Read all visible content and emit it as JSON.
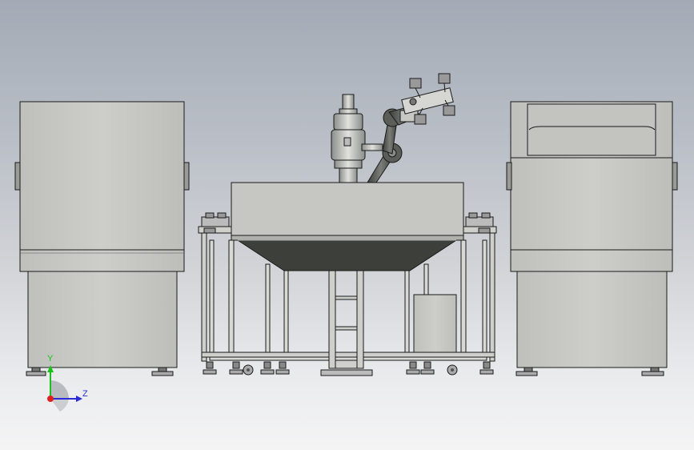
{
  "viewport": {
    "view": "front",
    "background_colors": [
      "#a3aab5",
      "#f4f4f5"
    ],
    "model_colors": {
      "panel": "#c9cac5",
      "edge": "#1a1a1a",
      "hopper": "#3d3f3a",
      "robot_arm": "#5a5d58",
      "metal": "#b8bab8"
    }
  },
  "triad": {
    "y_label": "Y",
    "z_label": "Z",
    "y_color": "#19c219",
    "z_color": "#2b2bd8",
    "x_color": "#e02020"
  }
}
